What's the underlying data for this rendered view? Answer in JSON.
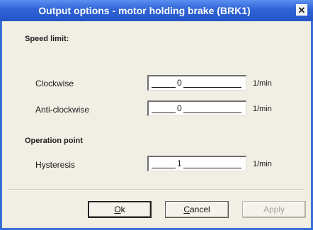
{
  "window": {
    "title": "Output options - motor holding brake (BRK1)",
    "close_glyph": "✕"
  },
  "speed_limit": {
    "heading": "Speed limit:",
    "clockwise": {
      "label": "Clockwise",
      "value": "0",
      "unit": "1/min"
    },
    "anticlockwise": {
      "label": "Anti-clockwise",
      "value": "0",
      "unit": "1/min"
    }
  },
  "operation_point": {
    "heading": "Operation point",
    "hysteresis": {
      "label": "Hysteresis",
      "value": "1",
      "unit": "1/min"
    }
  },
  "buttons": {
    "ok": {
      "mnemonic": "O",
      "rest": "k"
    },
    "cancel": {
      "mnemonic": "C",
      "rest": "ancel"
    },
    "apply": {
      "label": "Apply",
      "enabled": false
    }
  },
  "colors": {
    "titlebar": "#2f63d6",
    "dialog_bg": "#f1efe4"
  },
  "icons": {
    "close": "close-icon"
  }
}
